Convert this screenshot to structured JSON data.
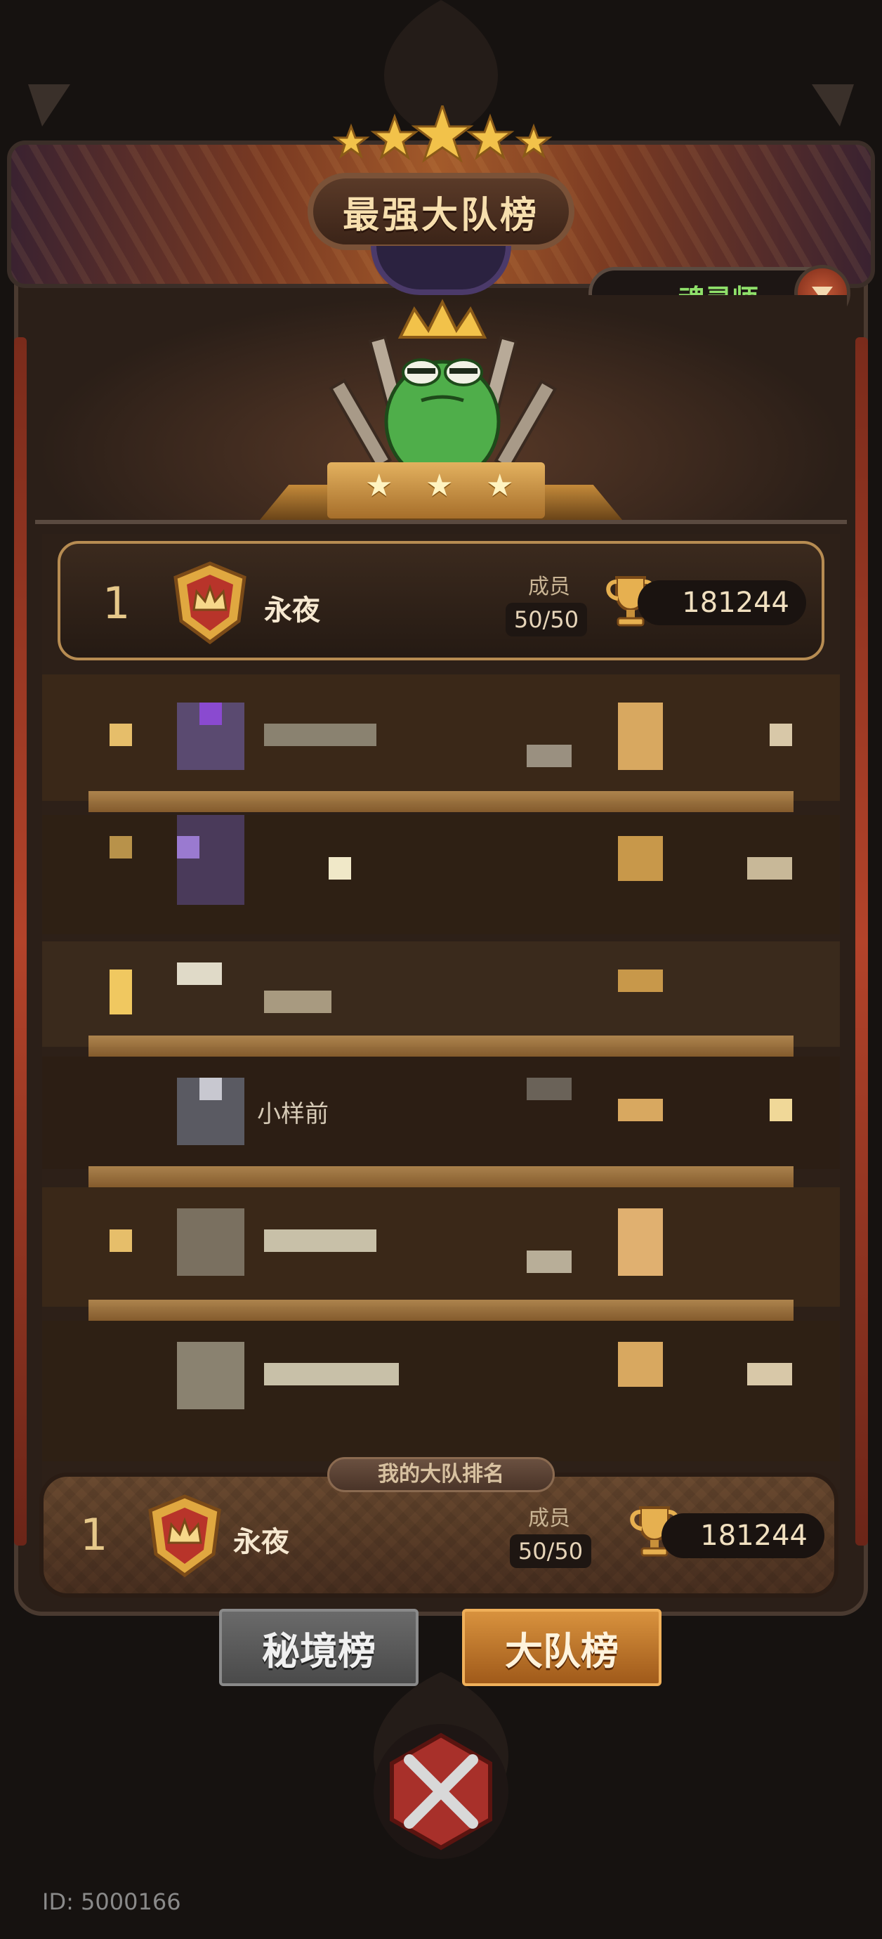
{
  "header": {
    "title": "最强大队榜",
    "class_filter": "魂灵师",
    "stars_count": 5
  },
  "top_entry": {
    "rank": "1",
    "name": "永夜",
    "member_label": "成员",
    "member_count": "50/50",
    "score": "181244"
  },
  "obscured_rows": [
    {
      "partial_text": ""
    },
    {
      "partial_text": ""
    },
    {
      "partial_text": ""
    },
    {
      "partial_text": "小样前"
    },
    {
      "partial_text": ""
    },
    {
      "partial_text": ""
    }
  ],
  "my_rank": {
    "section_label": "我的大队排名",
    "rank": "1",
    "name": "永夜",
    "member_label": "成员",
    "member_count": "50/50",
    "score": "181244"
  },
  "tabs": {
    "secret_realm": "秘境榜",
    "team": "大队榜",
    "active": "team"
  },
  "footer": {
    "id_text": "ID: 5000166"
  },
  "colors": {
    "accent_gold": "#e6c88a",
    "class_green": "#8fe06a",
    "active_tab": "#d8923e",
    "inactive_tab": "#6a6a6a"
  }
}
